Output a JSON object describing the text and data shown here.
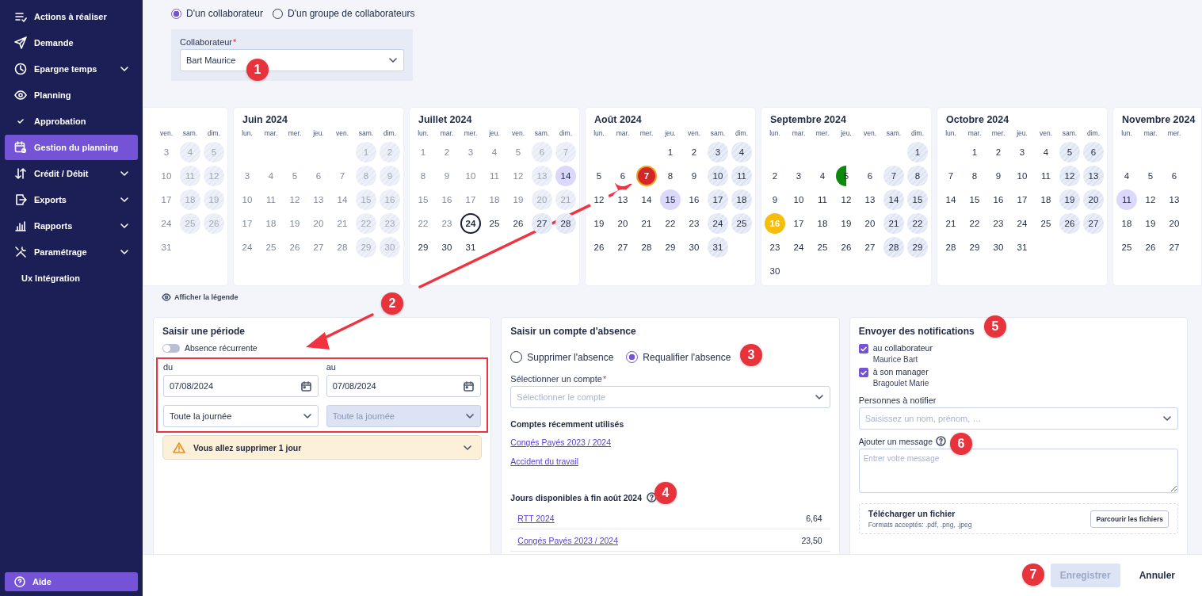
{
  "sidebar": {
    "items": [
      {
        "label": "Actions à réaliser",
        "expandable": false,
        "selected": false
      },
      {
        "label": "Demande",
        "expandable": false,
        "selected": false
      },
      {
        "label": "Epargne temps",
        "expandable": true,
        "selected": false
      },
      {
        "label": "Planning",
        "expandable": false,
        "selected": false
      },
      {
        "label": "Approbation",
        "expandable": false,
        "selected": false
      },
      {
        "label": "Gestion du planning",
        "expandable": false,
        "selected": true
      },
      {
        "label": "Crédit / Débit",
        "expandable": true,
        "selected": false
      },
      {
        "label": "Exports",
        "expandable": true,
        "selected": false
      },
      {
        "label": "Rapports",
        "expandable": true,
        "selected": false
      },
      {
        "label": "Paramétrage",
        "expandable": true,
        "selected": false
      },
      {
        "label": "Ux Intégration",
        "expandable": false,
        "selected": false
      }
    ],
    "help_button": "Aide"
  },
  "target": {
    "options": [
      {
        "label": "D'un collaborateur",
        "selected": true
      },
      {
        "label": "D'un groupe de collaborateurs",
        "selected": false
      }
    ],
    "field": {
      "label": "Collaborateur",
      "required_mark": "*",
      "value": "Bart Maurice"
    }
  },
  "calendar": {
    "months": [
      {
        "cut_left": true,
        "past": true,
        "weekdays": [
          "ven.",
          "sam.",
          "dim."
        ],
        "weeks": [
          {
            "days": [
              "3",
              "4",
              "5"
            ]
          },
          {
            "days": [
              "10",
              "11",
              "12"
            ]
          },
          {
            "days": [
              "17",
              "18",
              "19"
            ]
          },
          {
            "days": [
              "24",
              "25",
              "26"
            ]
          },
          {
            "days": [
              "31"
            ]
          }
        ]
      },
      {
        "title": "Juin 2024",
        "past": true,
        "weekdays": [
          "lun.",
          "mar.",
          "mer.",
          "jeu.",
          "ven.",
          "sam.",
          "dim."
        ],
        "weeks": [
          {
            "days": [
              "1",
              "2"
            ],
            "align_end": true
          },
          {
            "days": [
              "3",
              "4",
              "5",
              "6",
              "7",
              "8",
              "9"
            ]
          },
          {
            "days": [
              "10",
              "11",
              "12",
              "13",
              "14",
              "15",
              "16"
            ]
          },
          {
            "days": [
              "17",
              "18",
              "19",
              "20",
              "21",
              "22",
              "23"
            ]
          },
          {
            "days": [
              "24",
              "25",
              "26",
              "27",
              "28",
              "29",
              "30"
            ]
          }
        ]
      },
      {
        "title": "Juillet 2024",
        "past": false,
        "weekdays": [
          "lun.",
          "mar.",
          "mer.",
          "jeu.",
          "ven.",
          "sam.",
          "dim."
        ],
        "weeks": [
          {
            "days": [
              {
                "d": "1",
                "kind": "past"
              },
              {
                "d": "2",
                "kind": "past"
              },
              {
                "d": "3",
                "kind": "past"
              },
              {
                "d": "4",
                "kind": "past"
              },
              {
                "d": "5",
                "kind": "past"
              },
              {
                "d": "6",
                "kind": "past"
              },
              {
                "d": "7",
                "kind": "past"
              }
            ]
          },
          {
            "days": [
              {
                "d": "8",
                "kind": "past"
              },
              {
                "d": "9",
                "kind": "past"
              },
              {
                "d": "10",
                "kind": "past"
              },
              {
                "d": "11",
                "kind": "past"
              },
              {
                "d": "12",
                "kind": "past"
              },
              {
                "d": "13",
                "kind": "past"
              },
              {
                "d": "14",
                "kind": "holiday"
              }
            ]
          },
          {
            "days": [
              {
                "d": "15",
                "kind": "past"
              },
              {
                "d": "16",
                "kind": "past"
              },
              {
                "d": "17",
                "kind": "past"
              },
              {
                "d": "18",
                "kind": "past"
              },
              {
                "d": "19",
                "kind": "past"
              },
              {
                "d": "20",
                "kind": "past"
              },
              {
                "d": "21",
                "kind": "past"
              }
            ]
          },
          {
            "days": [
              {
                "d": "22",
                "kind": "past"
              },
              {
                "d": "23",
                "kind": "past"
              },
              {
                "d": "24",
                "kind": "today"
              },
              "25",
              "26",
              "27",
              "28"
            ]
          },
          {
            "days": [
              "29",
              "30",
              "31"
            ]
          }
        ]
      },
      {
        "title": "Août 2024",
        "past": false,
        "weekdays": [
          "lun.",
          "mar.",
          "mer.",
          "jeu.",
          "ven.",
          "sam.",
          "dim."
        ],
        "weeks": [
          {
            "days": [
              "1",
              "2",
              "3",
              "4"
            ],
            "align_end": true
          },
          {
            "days": [
              "5",
              "6",
              {
                "d": "7",
                "kind": "absence"
              },
              "8",
              "9",
              "10",
              "11"
            ]
          },
          {
            "days": [
              "12",
              "13",
              "14",
              {
                "d": "15",
                "kind": "holiday"
              },
              "16",
              "17",
              "18"
            ]
          },
          {
            "days": [
              "19",
              "20",
              "21",
              "22",
              "23",
              "24",
              "25"
            ]
          },
          {
            "days": [
              "26",
              "27",
              "28",
              "29",
              "30",
              "31"
            ]
          }
        ]
      },
      {
        "title": "Septembre 2024",
        "past": false,
        "weekdays": [
          "lun.",
          "mar.",
          "mer.",
          "jeu.",
          "ven.",
          "sam.",
          "dim."
        ],
        "weeks": [
          {
            "days": [
              "1"
            ],
            "align_end": true
          },
          {
            "days": [
              "2",
              "3",
              "4",
              {
                "d": "5",
                "kind": "half"
              },
              "6",
              "7",
              "8"
            ]
          },
          {
            "days": [
              "9",
              "10",
              "11",
              "12",
              "13",
              "14",
              "15"
            ]
          },
          {
            "days": [
              {
                "d": "16",
                "kind": "alert"
              },
              "17",
              "18",
              "19",
              "20",
              "21",
              "22"
            ]
          },
          {
            "days": [
              "23",
              "24",
              "25",
              "26",
              "27",
              "28",
              "29"
            ]
          },
          {
            "days": [
              "30"
            ]
          }
        ]
      },
      {
        "title": "Octobre 2024",
        "past": false,
        "weekdays": [
          "lun.",
          "mar.",
          "mer.",
          "jeu.",
          "ven.",
          "sam.",
          "dim."
        ],
        "weeks": [
          {
            "days": [
              "1",
              "2",
              "3",
              "4",
              "5",
              "6"
            ],
            "align_end": true
          },
          {
            "days": [
              "7",
              "8",
              "9",
              "10",
              "11",
              "12",
              "13"
            ]
          },
          {
            "days": [
              "14",
              "15",
              "16",
              "17",
              "18",
              "19",
              "20"
            ]
          },
          {
            "days": [
              "21",
              "22",
              "23",
              "24",
              "25",
              "26",
              "27"
            ]
          },
          {
            "days": [
              "28",
              "29",
              "30",
              "31"
            ]
          }
        ]
      },
      {
        "title": "Novembre 2024",
        "cut_right": true,
        "blank_first_week": true,
        "past": false,
        "weekdays": [
          "lun.",
          "mar.",
          "mer."
        ],
        "weeks": [
          {
            "days": [
              "4",
              "5",
              "6"
            ]
          },
          {
            "days": [
              {
                "d": "11",
                "kind": "holiday"
              },
              "12",
              "13"
            ]
          },
          {
            "days": [
              "18",
              "19",
              "20"
            ]
          },
          {
            "days": [
              "25",
              "26",
              "27"
            ]
          }
        ]
      }
    ],
    "legend_link": "Afficher la légende"
  },
  "period": {
    "title": "Saisir une période",
    "recurring": {
      "label": "Absence récurrente",
      "on": false
    },
    "from": {
      "label": "du",
      "date": "07/08/2024",
      "span": "Toute la journée",
      "span_disabled": false
    },
    "to": {
      "label": "au",
      "date": "07/08/2024",
      "span": "Toute la journée",
      "span_disabled": true
    },
    "warning": "Vous allez supprimer 1 jour"
  },
  "account": {
    "title": "Saisir un compte d'absence",
    "actions": [
      {
        "label": "Supprimer l'absence",
        "selected": false
      },
      {
        "label": "Requalifier l'absence",
        "selected": true
      }
    ],
    "select": {
      "label": "Sélectionner un compte",
      "required_mark": "*",
      "placeholder": "Sélectionner le compte"
    },
    "recent_title": "Comptes récemment utilisés",
    "recent": [
      "Congés Payés 2023 / 2024",
      "Accident du travail"
    ],
    "balance_title": "Jours disponibles à fin août 2024",
    "balances": [
      {
        "name": "RTT 2024",
        "value": "6,64"
      },
      {
        "name": "Congés Payés 2023 / 2024",
        "value": "23,50"
      }
    ]
  },
  "notifications": {
    "title": "Envoyer des notifications",
    "recipients": [
      {
        "label": "au collaborateur",
        "person": "Maurice Bart",
        "checked": true
      },
      {
        "label": "à son manager",
        "person": "Bragoulet Marie",
        "checked": true
      }
    ],
    "people": {
      "label": "Personnes à notifier",
      "placeholder": "Saisissez un nom, prénom, …"
    },
    "message": {
      "label": "Ajouter un message",
      "placeholder": "Entrer votre message"
    },
    "upload": {
      "title": "Télécharger un fichier",
      "formats": "Formats acceptés: .pdf, .png, .jpeg",
      "button": "Parcourir les fichiers"
    }
  },
  "footer": {
    "save": {
      "label": "Enregistrer",
      "disabled": true
    },
    "cancel": "Annuler"
  },
  "annotations": [
    {
      "label": "1"
    },
    {
      "label": "2"
    },
    {
      "label": "3"
    },
    {
      "label": "4"
    },
    {
      "label": "5"
    },
    {
      "label": "6"
    },
    {
      "label": "7"
    }
  ]
}
